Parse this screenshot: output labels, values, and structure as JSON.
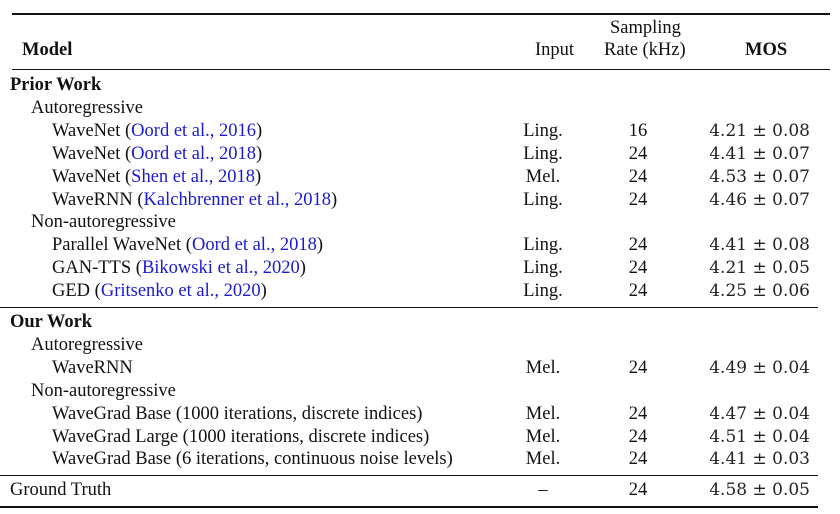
{
  "header": {
    "model": "Model",
    "input": "Input",
    "rate_line1": "Sampling",
    "rate_line2": "Rate (kHz)",
    "mos": "MOS"
  },
  "sections": [
    {
      "title": "Prior Work",
      "groups": [
        {
          "title": "Autoregressive",
          "rows": [
            {
              "model": "WaveNet",
              "open": " (",
              "cite": "Oord et al., 2016",
              "close": ")",
              "input": "Ling.",
              "rate": "16",
              "mos": "4.21 ± 0.08"
            },
            {
              "model": "WaveNet",
              "open": " (",
              "cite": "Oord et al., 2018",
              "close": ")",
              "input": "Ling.",
              "rate": "24",
              "mos": "4.41 ± 0.07"
            },
            {
              "model": "WaveNet",
              "open": " (",
              "cite": "Shen et al., 2018",
              "close": ")",
              "input": "Mel.",
              "rate": "24",
              "mos": "4.53 ± 0.07"
            },
            {
              "model": "WaveRNN",
              "open": " (",
              "cite": "Kalchbrenner et al., 2018",
              "close": ")",
              "input": "Ling.",
              "rate": "24",
              "mos": "4.46 ± 0.07"
            }
          ]
        },
        {
          "title": "Non-autoregressive",
          "rows": [
            {
              "model": "Parallel WaveNet",
              "open": " (",
              "cite": "Oord et al., 2018",
              "close": ")",
              "input": "Ling.",
              "rate": "24",
              "mos": "4.41 ± 0.08"
            },
            {
              "model": "GAN-TTS",
              "open": " (",
              "cite": "Bikowski et al., 2020",
              "close": ")",
              "input": "Ling.",
              "rate": "24",
              "mos": "4.21 ± 0.05"
            },
            {
              "model": "GED",
              "open": " (",
              "cite": "Gritsenko et al., 2020",
              "close": ")",
              "input": "Ling.",
              "rate": "24",
              "mos": "4.25 ± 0.06"
            }
          ]
        }
      ]
    },
    {
      "title": "Our Work",
      "groups": [
        {
          "title": "Autoregressive",
          "rows": [
            {
              "model": "WaveRNN",
              "input": "Mel.",
              "rate": "24",
              "mos": "4.49 ± 0.04"
            }
          ]
        },
        {
          "title": "Non-autoregressive",
          "rows": [
            {
              "model": "WaveGrad Base (1000 iterations, discrete indices)",
              "input": "Mel.",
              "rate": "24",
              "mos": "4.47 ± 0.04"
            },
            {
              "model": "WaveGrad Large (1000 iterations, discrete indices)",
              "input": "Mel.",
              "rate": "24",
              "mos": "4.51 ± 0.04"
            },
            {
              "model": "WaveGrad Base (6 iterations, continuous noise levels)",
              "input": "Mel.",
              "rate": "24",
              "mos": "4.41 ± 0.03"
            }
          ]
        }
      ]
    }
  ],
  "ground_truth": {
    "model": "Ground Truth",
    "input": "–",
    "rate": "24",
    "mos": "4.58 ± 0.05"
  },
  "colors": {
    "citation": "#1a1ad6",
    "text": "#111111"
  }
}
